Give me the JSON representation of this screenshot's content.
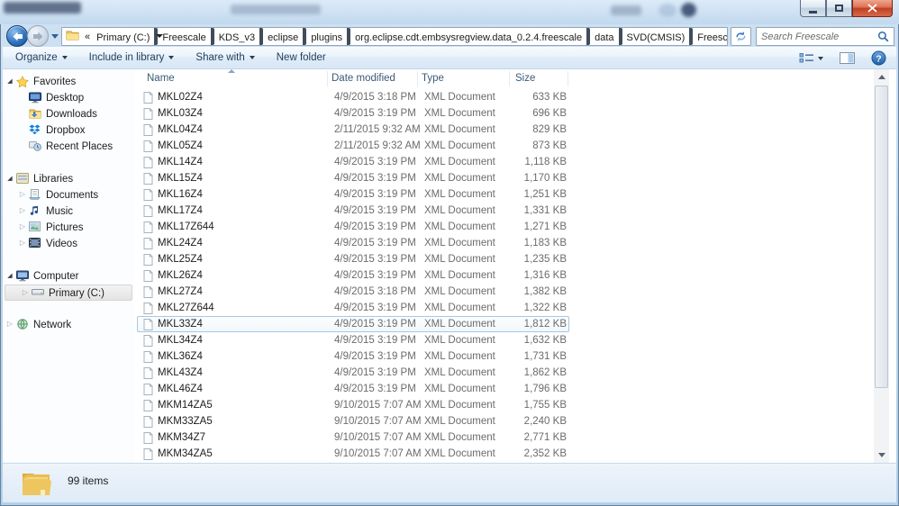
{
  "window": {
    "controls": {
      "minimize": "minimize",
      "maximize": "maximize",
      "close": "close"
    }
  },
  "navbar": {
    "back_tooltip": "Back",
    "forward_tooltip": "Forward",
    "breadcrumb": {
      "overflow_chevron": "«",
      "segments": [
        "Primary (C:)",
        "Freescale",
        "KDS_v3",
        "eclipse",
        "plugins",
        "org.eclipse.cdt.embsysregview.data_0.2.4.freescale",
        "data",
        "SVD(CMSIS)",
        "Freescale"
      ]
    },
    "search": {
      "placeholder": "Search Freescale"
    }
  },
  "toolbar": {
    "buttons": [
      {
        "label": "Organize",
        "dropdown": true
      },
      {
        "label": "Include in library",
        "dropdown": true
      },
      {
        "label": "Share with",
        "dropdown": true
      },
      {
        "label": "New folder",
        "dropdown": false
      }
    ],
    "right_icons": [
      "views-icon",
      "preview-pane-icon",
      "help-icon"
    ]
  },
  "sidebar": {
    "items": [
      {
        "label": "Favorites",
        "icon": "star-icon",
        "expander": "expanded",
        "indent": 0,
        "gap_before": false,
        "selected": false
      },
      {
        "label": "Desktop",
        "icon": "desktop-icon",
        "expander": "none",
        "indent": 1,
        "gap_before": false,
        "selected": false
      },
      {
        "label": "Downloads",
        "icon": "downloads-icon",
        "expander": "none",
        "indent": 1,
        "gap_before": false,
        "selected": false
      },
      {
        "label": "Dropbox",
        "icon": "dropbox-icon",
        "expander": "none",
        "indent": 1,
        "gap_before": false,
        "selected": false
      },
      {
        "label": "Recent Places",
        "icon": "recent-places-icon",
        "expander": "none",
        "indent": 1,
        "gap_before": false,
        "selected": false
      },
      {
        "label": "Libraries",
        "icon": "libraries-icon",
        "expander": "expanded",
        "indent": 0,
        "gap_before": true,
        "selected": false
      },
      {
        "label": "Documents",
        "icon": "documents-icon",
        "expander": "collapsed",
        "indent": 1,
        "gap_before": false,
        "selected": false
      },
      {
        "label": "Music",
        "icon": "music-icon",
        "expander": "collapsed",
        "indent": 1,
        "gap_before": false,
        "selected": false
      },
      {
        "label": "Pictures",
        "icon": "pictures-icon",
        "expander": "collapsed",
        "indent": 1,
        "gap_before": false,
        "selected": false
      },
      {
        "label": "Videos",
        "icon": "videos-icon",
        "expander": "collapsed",
        "indent": 1,
        "gap_before": false,
        "selected": false
      },
      {
        "label": "Computer",
        "icon": "computer-icon",
        "expander": "expanded",
        "indent": 0,
        "gap_before": true,
        "selected": false
      },
      {
        "label": "Primary (C:)",
        "icon": "drive-icon",
        "expander": "collapsed",
        "indent": 1,
        "gap_before": false,
        "selected": true
      },
      {
        "label": "Network",
        "icon": "network-icon",
        "expander": "collapsed",
        "indent": 0,
        "gap_before": true,
        "selected": false
      }
    ]
  },
  "filelist": {
    "columns": [
      {
        "label": "Name"
      },
      {
        "label": "Date modified"
      },
      {
        "label": "Type"
      },
      {
        "label": "Size"
      }
    ],
    "sort": {
      "column": "Name",
      "direction": "ascending"
    },
    "rows": [
      {
        "name": "MKL02Z4",
        "date": "4/9/2015 3:18 PM",
        "type": "XML Document",
        "size": "633 KB",
        "selected": false
      },
      {
        "name": "MKL03Z4",
        "date": "4/9/2015 3:19 PM",
        "type": "XML Document",
        "size": "696 KB",
        "selected": false
      },
      {
        "name": "MKL04Z4",
        "date": "2/11/2015 9:32 AM",
        "type": "XML Document",
        "size": "829 KB",
        "selected": false
      },
      {
        "name": "MKL05Z4",
        "date": "2/11/2015 9:32 AM",
        "type": "XML Document",
        "size": "873 KB",
        "selected": false
      },
      {
        "name": "MKL14Z4",
        "date": "4/9/2015 3:19 PM",
        "type": "XML Document",
        "size": "1,118 KB",
        "selected": false
      },
      {
        "name": "MKL15Z4",
        "date": "4/9/2015 3:19 PM",
        "type": "XML Document",
        "size": "1,170 KB",
        "selected": false
      },
      {
        "name": "MKL16Z4",
        "date": "4/9/2015 3:19 PM",
        "type": "XML Document",
        "size": "1,251 KB",
        "selected": false
      },
      {
        "name": "MKL17Z4",
        "date": "4/9/2015 3:19 PM",
        "type": "XML Document",
        "size": "1,331 KB",
        "selected": false
      },
      {
        "name": "MKL17Z644",
        "date": "4/9/2015 3:19 PM",
        "type": "XML Document",
        "size": "1,271 KB",
        "selected": false
      },
      {
        "name": "MKL24Z4",
        "date": "4/9/2015 3:19 PM",
        "type": "XML Document",
        "size": "1,183 KB",
        "selected": false
      },
      {
        "name": "MKL25Z4",
        "date": "4/9/2015 3:19 PM",
        "type": "XML Document",
        "size": "1,235 KB",
        "selected": false
      },
      {
        "name": "MKL26Z4",
        "date": "4/9/2015 3:19 PM",
        "type": "XML Document",
        "size": "1,316 KB",
        "selected": false
      },
      {
        "name": "MKL27Z4",
        "date": "4/9/2015 3:18 PM",
        "type": "XML Document",
        "size": "1,382 KB",
        "selected": false
      },
      {
        "name": "MKL27Z644",
        "date": "4/9/2015 3:19 PM",
        "type": "XML Document",
        "size": "1,322 KB",
        "selected": false
      },
      {
        "name": "MKL33Z4",
        "date": "4/9/2015 3:19 PM",
        "type": "XML Document",
        "size": "1,812 KB",
        "selected": true
      },
      {
        "name": "MKL34Z4",
        "date": "4/9/2015 3:19 PM",
        "type": "XML Document",
        "size": "1,632 KB",
        "selected": false
      },
      {
        "name": "MKL36Z4",
        "date": "4/9/2015 3:19 PM",
        "type": "XML Document",
        "size": "1,731 KB",
        "selected": false
      },
      {
        "name": "MKL43Z4",
        "date": "4/9/2015 3:19 PM",
        "type": "XML Document",
        "size": "1,862 KB",
        "selected": false
      },
      {
        "name": "MKL46Z4",
        "date": "4/9/2015 3:19 PM",
        "type": "XML Document",
        "size": "1,796 KB",
        "selected": false
      },
      {
        "name": "MKM14ZA5",
        "date": "9/10/2015 7:07 AM",
        "type": "XML Document",
        "size": "1,755 KB",
        "selected": false
      },
      {
        "name": "MKM33ZA5",
        "date": "9/10/2015 7:07 AM",
        "type": "XML Document",
        "size": "2,240 KB",
        "selected": false
      },
      {
        "name": "MKM34Z7",
        "date": "9/10/2015 7:07 AM",
        "type": "XML Document",
        "size": "2,771 KB",
        "selected": false
      },
      {
        "name": "MKM34ZA5",
        "date": "9/10/2015 7:07 AM",
        "type": "XML Document",
        "size": "2,352 KB",
        "selected": false
      }
    ]
  },
  "statusbar": {
    "items_text": "99 items"
  }
}
